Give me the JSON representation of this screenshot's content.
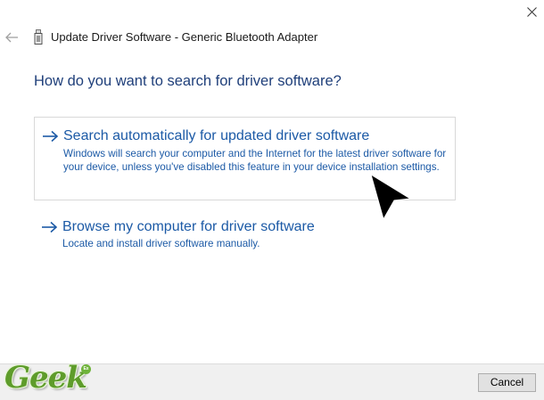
{
  "window": {
    "title": "Update Driver Software - Generic Bluetooth Adapter",
    "close_icon": "close-icon",
    "back_icon": "back-arrow-icon",
    "device_icon": "usb-device-icon"
  },
  "main": {
    "heading": "How do you want to search for driver software?",
    "options": [
      {
        "title": "Search automatically for updated driver software",
        "description": "Windows will search your computer and the Internet for the latest driver software for your device, unless you've disabled this feature in your device installation settings.",
        "icon": "arrow-right-icon"
      },
      {
        "title": "Browse my computer for driver software",
        "description": "Locate and install driver software manually.",
        "icon": "arrow-right-icon"
      }
    ]
  },
  "footer": {
    "cancel_label": "Cancel"
  },
  "watermark": {
    "text": "Geek",
    "badge": "Ex"
  },
  "colors": {
    "heading": "#1f3f7a",
    "link": "#1c5aa6",
    "footer_bg": "#f0f0f0",
    "logo_green": "#5e9c2b"
  }
}
